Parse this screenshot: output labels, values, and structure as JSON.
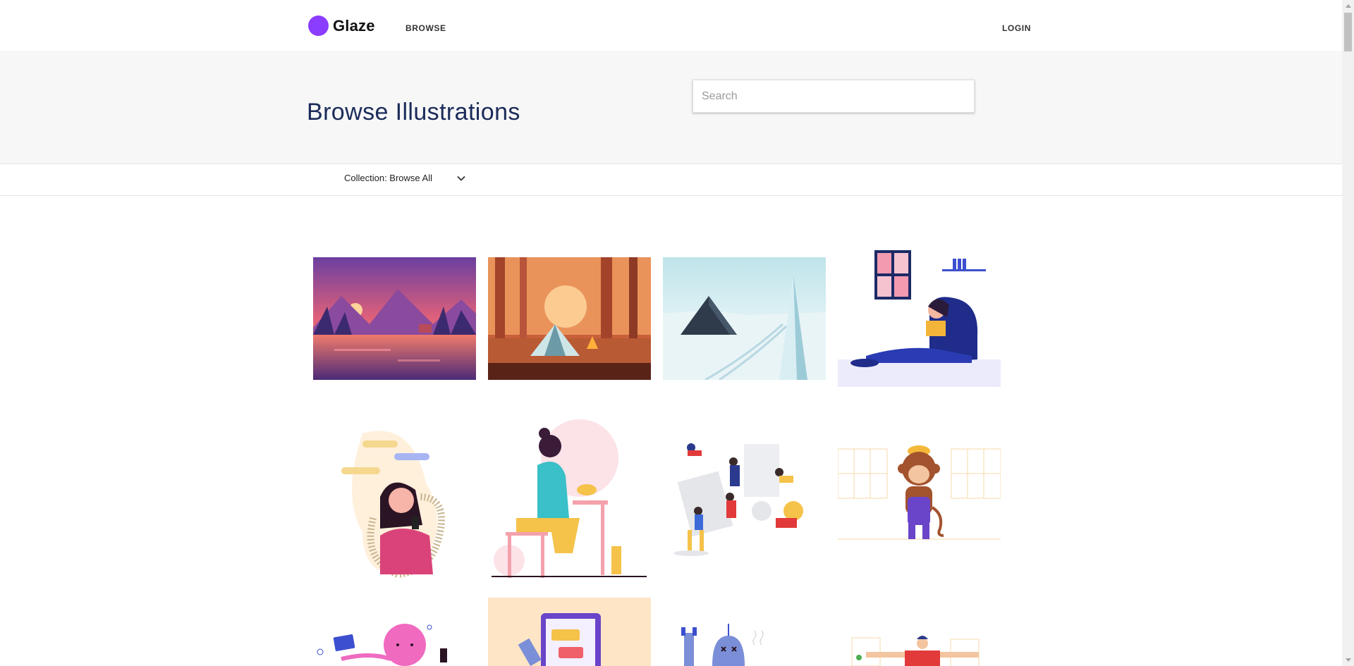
{
  "header": {
    "logo_text": "Glaze",
    "nav": {
      "browse_label": "BROWSE",
      "login_label": "LOGIN"
    }
  },
  "hero": {
    "title": "Browse Illustrations",
    "search": {
      "placeholder": "Search",
      "value": ""
    }
  },
  "filter": {
    "collection_label": "Collection: Browse All"
  },
  "colors": {
    "brand": "#8a3cff",
    "title": "#1b2b5a",
    "hero_bg": "#f7f7f7"
  },
  "illustrations": [
    {
      "subject": "mountain-lake-sunset"
    },
    {
      "subject": "forest-tent-campfire"
    },
    {
      "subject": "snowy-cabin"
    },
    {
      "subject": "woman-reading-armchair"
    },
    {
      "subject": "woman-phone-chat-bubbles"
    },
    {
      "subject": "woman-sitting-coffee"
    },
    {
      "subject": "team-building-interface"
    },
    {
      "subject": "monkey-hardhat"
    },
    {
      "subject": "octopus-laptop"
    },
    {
      "subject": "phone-chat-messages"
    },
    {
      "subject": "robot-broken"
    },
    {
      "subject": "man-workshop"
    }
  ]
}
